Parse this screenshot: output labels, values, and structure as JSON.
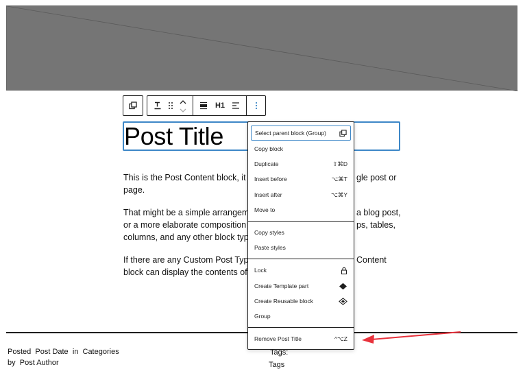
{
  "toolbar": {
    "parent_icon": "select-parent-icon",
    "transform_icon": "title-icon",
    "drag_icon": "drag-handle-icon",
    "move_up_icon": "chevron-up-icon",
    "move_down_icon": "chevron-down-icon",
    "align_icon": "align-icon",
    "heading_level": "H1",
    "text_align_icon": "text-align-left-icon",
    "more_options_icon": "more-vertical-icon",
    "accent_color": "#3d87c7"
  },
  "post": {
    "title": "Post Title",
    "paragraphs": [
      "This is the Post Content block, it will",
      "gle post or",
      "page.",
      "That might be a simple arrangement",
      "a blog post,",
      "or a more elaborate composition tha",
      "ps, tables,",
      "columns, and any other block types.",
      "If there are any Custom Post Types r",
      "Content",
      "block can display the contents of tho"
    ]
  },
  "footer": {
    "posted": "Posted",
    "post_date": "Post Date",
    "in": "in",
    "categories": "Categories",
    "by": "by",
    "post_author": "Post Author",
    "tags_label": "Tags:",
    "tags": "Tags"
  },
  "menu": {
    "items": [
      {
        "label": "Select parent block (Group)",
        "shortcut": "",
        "icon": "select-parent-icon"
      },
      {
        "label": "Copy block",
        "shortcut": ""
      },
      {
        "label": "Duplicate",
        "shortcut": "⇧⌘D"
      },
      {
        "label": "Insert before",
        "shortcut": "⌥⌘T"
      },
      {
        "label": "Insert after",
        "shortcut": "⌥⌘Y"
      },
      {
        "label": "Move to",
        "shortcut": ""
      },
      {
        "label": "Copy styles",
        "shortcut": ""
      },
      {
        "label": "Paste styles",
        "shortcut": ""
      },
      {
        "label": "Lock",
        "shortcut": "",
        "icon": "lock-icon"
      },
      {
        "label": "Create Template part",
        "shortcut": "",
        "icon": "template-part-icon"
      },
      {
        "label": "Create Reusable block",
        "shortcut": "",
        "icon": "reusable-block-icon"
      },
      {
        "label": "Group",
        "shortcut": ""
      },
      {
        "label": "Remove Post Title",
        "shortcut": "^⌥Z"
      }
    ]
  },
  "annotation": {
    "arrow_color": "#e8323c"
  }
}
